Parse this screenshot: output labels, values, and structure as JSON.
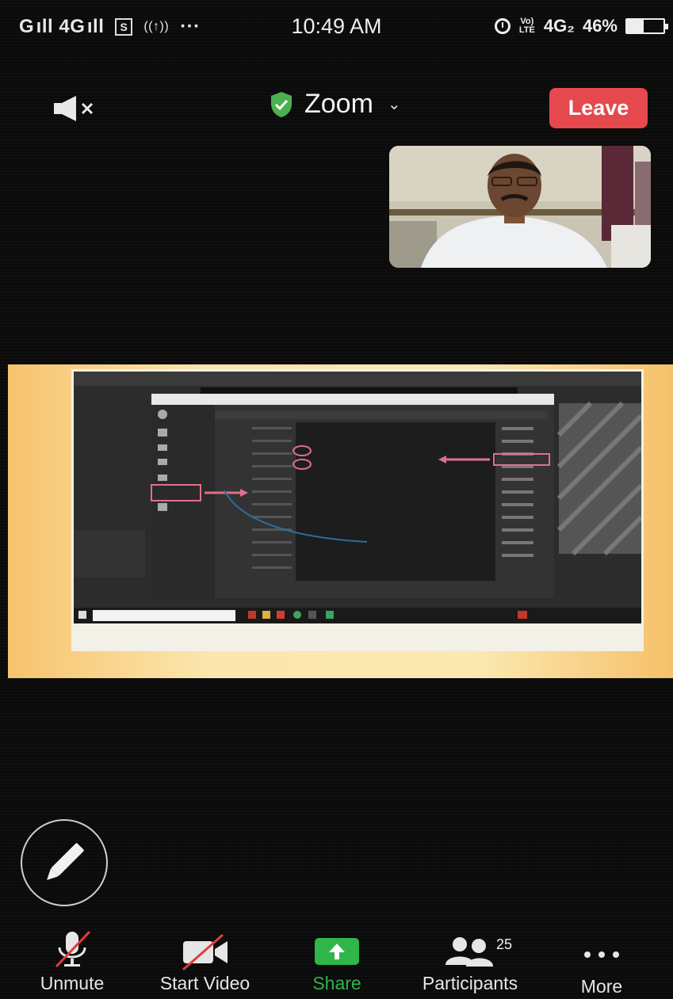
{
  "status_bar": {
    "carrier_left": "G ıll 4G ıll",
    "sim_icon_text": "S",
    "wifi_calling": "((↑))",
    "more": "···",
    "time": "10:49 AM",
    "lte_label": "Vo) LTE",
    "network": "4G₂",
    "battery_percent": "46%",
    "battery_level": 0.46
  },
  "header": {
    "title": "Zoom",
    "leave_label": "Leave",
    "shield_color": "#4cb050",
    "leave_color": "#e5484d"
  },
  "toolbar": {
    "items": [
      {
        "label": "Unmute",
        "icon": "microphone-muted-icon"
      },
      {
        "label": "Start Video",
        "icon": "video-off-icon"
      },
      {
        "label": "Share",
        "icon": "share-arrow-icon"
      },
      {
        "label": "Participants",
        "icon": "participants-icon",
        "count": "25"
      },
      {
        "label": "More",
        "icon": "more-dots-icon"
      }
    ],
    "share_color": "#2fb54a"
  }
}
